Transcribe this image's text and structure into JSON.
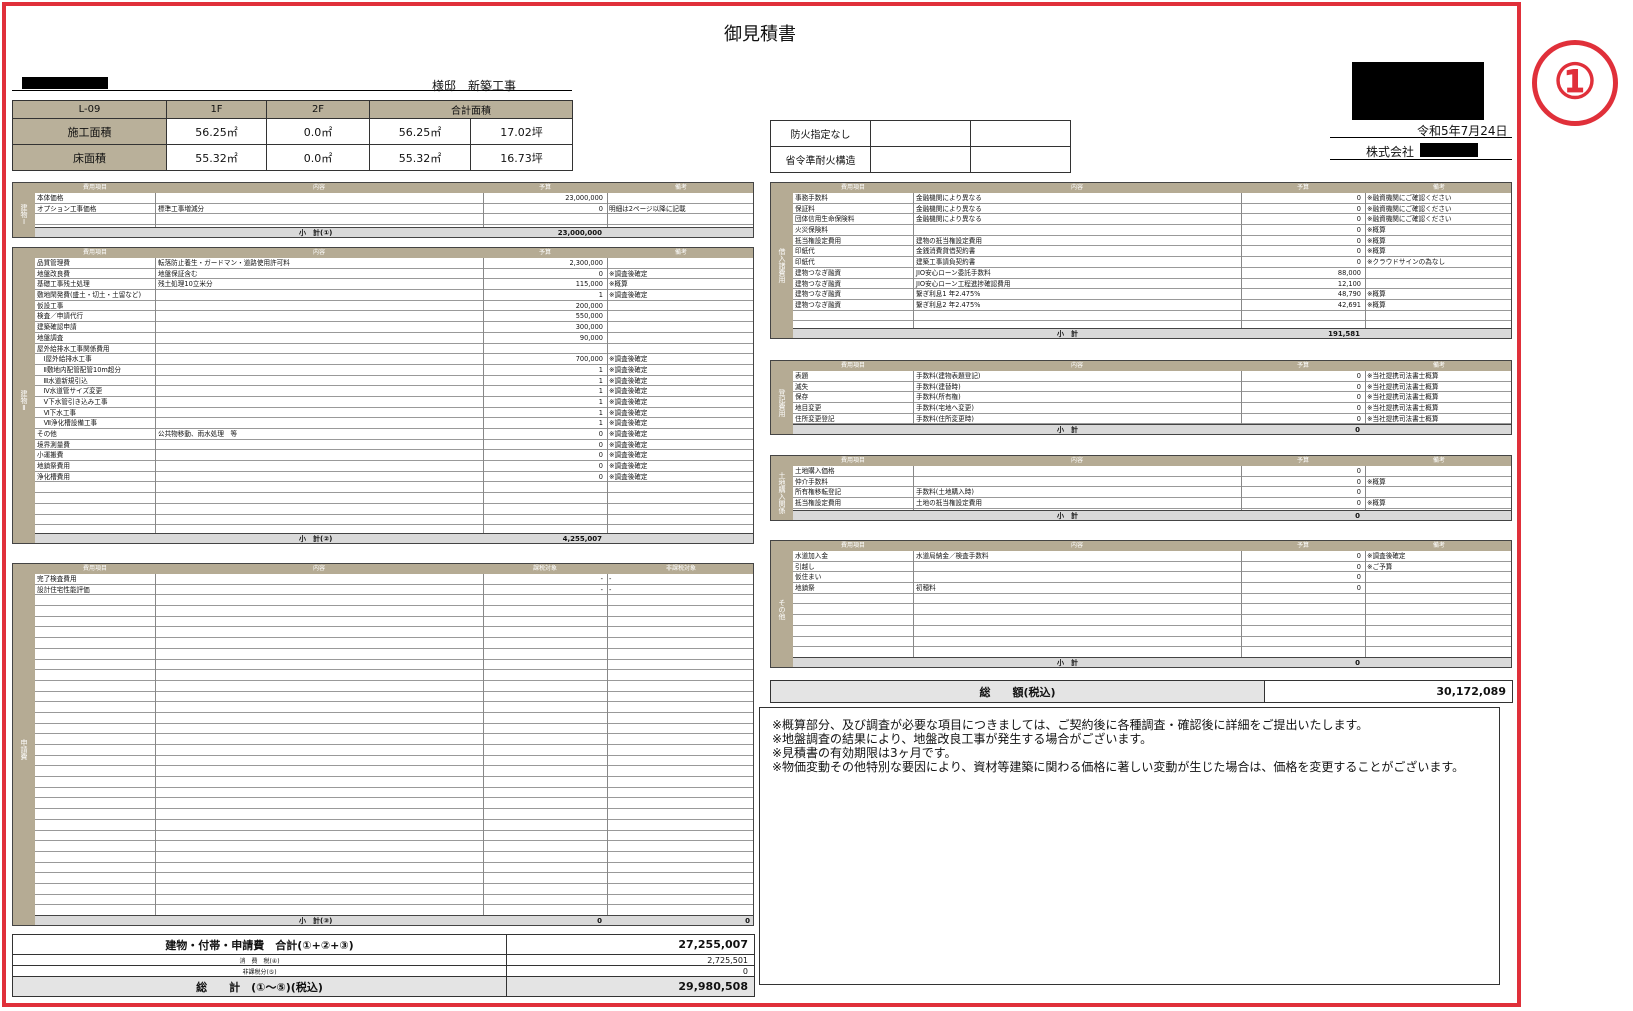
{
  "doc": {
    "title": "御見積書",
    "recipient": "様邸　新築工事",
    "date": "令和5年7月24日",
    "company": "株式会社",
    "badge": "①"
  },
  "area": {
    "h0": "L-09",
    "h1": "1F",
    "h2": "2F",
    "h3": "合計面積",
    "r1": [
      "施工面積",
      "56.25㎡",
      "0.0㎡",
      "56.25㎡",
      "17.02坪"
    ],
    "r2": [
      "床面積",
      "55.32㎡",
      "0.0㎡",
      "55.32㎡",
      "16.73坪"
    ]
  },
  "fire": {
    "a": "防火指定なし",
    "b": "省令準耐火構造"
  },
  "hdr": {
    "item": "費用項目",
    "content": "内容",
    "budget": "予算",
    "note": "備考",
    "tax": "課税対象",
    "notax": "非課税対象"
  },
  "s1": {
    "side": "建物Ⅰ",
    "rows": [
      [
        "本体価格",
        "",
        "23,000,000",
        ""
      ],
      [
        "オプション工事価格",
        "標準工事増減分",
        "0",
        "明細は2ページ以降に記載"
      ],
      [
        "",
        "",
        "",
        ""
      ]
    ],
    "sub": "小　計(①)",
    "total": "23,000,000"
  },
  "s2": {
    "side": "建物Ⅱ",
    "rows": [
      [
        "品質管理費",
        "転落防止養生・ガードマン・道路使用許可料",
        "2,300,000",
        ""
      ],
      [
        "地盤改良費",
        "地盤保証含む",
        "0",
        "※調査後確定"
      ],
      [
        "基礎工事残土処理",
        "残土処理10立米分",
        "115,000",
        "※概算"
      ],
      [
        "敷地閑発費(盛土・切土・土留など)",
        "",
        "1",
        "※調査後確定"
      ],
      [
        "仮設工事",
        "",
        "200,000",
        ""
      ],
      [
        "検査／申請代行",
        "",
        "550,000",
        ""
      ],
      [
        "建築確認申請",
        "",
        "300,000",
        ""
      ],
      [
        "地盤調査",
        "",
        "90,000",
        ""
      ],
      [
        "屋外給排水工事関係費用",
        "",
        "",
        ""
      ],
      [
        "　Ⅰ屋外給排水工事",
        "",
        "700,000",
        "※調査後確定"
      ],
      [
        "　Ⅱ敷地内配管配管10m超分",
        "",
        "1",
        "※調査後確定"
      ],
      [
        "　Ⅲ水道新規引込",
        "",
        "1",
        "※調査後確定"
      ],
      [
        "　Ⅳ水道管サイズ変更",
        "",
        "1",
        "※調査後確定"
      ],
      [
        "　Ⅴ下水管引き込み工事",
        "",
        "1",
        "※調査後確定"
      ],
      [
        "　Ⅵ下水工事",
        "",
        "1",
        "※調査後確定"
      ],
      [
        "　Ⅶ浄化槽設備工事",
        "",
        "1",
        "※調査後確定"
      ],
      [
        "その他",
        "公共物移動、雨水処理　等",
        "0",
        "※調査後確定"
      ],
      [
        "境界測量費",
        "",
        "0",
        "※調査後確定"
      ],
      [
        "小運搬費",
        "",
        "0",
        "※調査後確定"
      ],
      [
        "地鎮祭費用",
        "",
        "0",
        "※調査後確定"
      ],
      [
        "浄化槽費用",
        "",
        "0",
        "※調査後確定"
      ]
    ],
    "sub": "小　計(②)",
    "total": "4,255,007"
  },
  "s3": {
    "side": "申請費",
    "rows": [
      [
        "完了検査費用",
        "",
        "-",
        "-"
      ],
      [
        "設計住宅性能評価",
        "",
        "-",
        "-"
      ]
    ],
    "sub": "小　計(③)",
    "total": "0",
    "total2": "0"
  },
  "sum": {
    "a": "建物・付帯・申請費　合計(①+②+③)",
    "av": "27,255,007",
    "b": "消　費　税(④)",
    "bv": "2,725,501",
    "c": "非課税分(⑤)",
    "cv": "0",
    "d": "総　　計　(①〜⑤)(税込)",
    "dv": "29,980,508"
  },
  "r1": {
    "side": "借入諸費用",
    "rows": [
      [
        "事務手数料",
        "金融機関により異なる",
        "0",
        "※融資機関にご確認ください"
      ],
      [
        "保証料",
        "金融機関により異なる",
        "0",
        "※融資機関にご確認ください"
      ],
      [
        "団体信用生命保険料",
        "金融機関により異なる",
        "0",
        "※融資機関にご確認ください"
      ],
      [
        "火災保険料",
        "",
        "0",
        "※概算"
      ],
      [
        "抵当権設定費用",
        "建物の抵当権設定費用",
        "0",
        "※概算"
      ],
      [
        "印紙代",
        "金銭消費貸借契約書",
        "0",
        "※概算"
      ],
      [
        "印紙代",
        "建築工事請負契約書",
        "0",
        "※クラウドサインの為なし"
      ],
      [
        "建物つなぎ融資",
        "JIO安心ローン委託手数料",
        "88,000",
        ""
      ],
      [
        "建物つなぎ融資",
        "JIO安心ローン工程進捗確認費用",
        "12,100",
        ""
      ],
      [
        "建物つなぎ融資",
        "繋ぎ利息1 年2.475%",
        "48,790",
        "※概算"
      ],
      [
        "建物つなぎ融資",
        "繋ぎ利息2 年2.475%",
        "42,691",
        "※概算"
      ]
    ],
    "sub": "小　計",
    "total": "191,581"
  },
  "r2": {
    "side": "登記費用",
    "rows": [
      [
        "表題",
        "手数料(建物表題登記)",
        "0",
        "※当社提携司法書士概算"
      ],
      [
        "滅失",
        "手数料(建替時)",
        "0",
        "※当社提携司法書士概算"
      ],
      [
        "保存",
        "手数料(所有権)",
        "0",
        "※当社提携司法書士概算"
      ],
      [
        "地目変更",
        "手数料(宅地へ変更)",
        "0",
        "※当社提携司法書士概算"
      ],
      [
        "住所変更登記",
        "手数料(住所変更時)",
        "0",
        "※当社提携司法書士概算"
      ]
    ],
    "sub": "小　計",
    "total": "0"
  },
  "r3": {
    "side": "土地購入関係",
    "rows": [
      [
        "土地購入価格",
        "",
        "0",
        ""
      ],
      [
        "仲介手数料",
        "",
        "0",
        "※概算"
      ],
      [
        "所有権移転登記",
        "手数料(土地購入時)",
        "0",
        ""
      ],
      [
        "抵当権設定費用",
        "土地の抵当権設定費用",
        "0",
        "※概算"
      ]
    ],
    "sub": "小　計",
    "total": "0"
  },
  "r4": {
    "side": "その他",
    "rows": [
      [
        "水道加入金",
        "水道局納金／検査手数料",
        "0",
        "※調査後確定"
      ],
      [
        "引越し",
        "",
        "0",
        "※ご予算"
      ],
      [
        "仮住まい",
        "",
        "0",
        ""
      ],
      [
        "地鎮祭",
        "初穂料",
        "0",
        ""
      ]
    ],
    "sub": "小　計",
    "total": "0"
  },
  "grand": {
    "label": "総　　額(税込)",
    "value": "30,172,089"
  },
  "notes": [
    "※概算部分、及び調査が必要な項目につきましては、ご契約後に各種調査・確認後に詳細をご提出いたします。",
    "※地盤調査の結果により、地盤改良工事が発生する場合がございます。",
    "※見積書の有効期限は3ヶ月です。",
    "※物価変動その他特別な要因により、資材等建築に関わる価格に著しい変動が生じた場合は、価格を変更することがございます。"
  ]
}
